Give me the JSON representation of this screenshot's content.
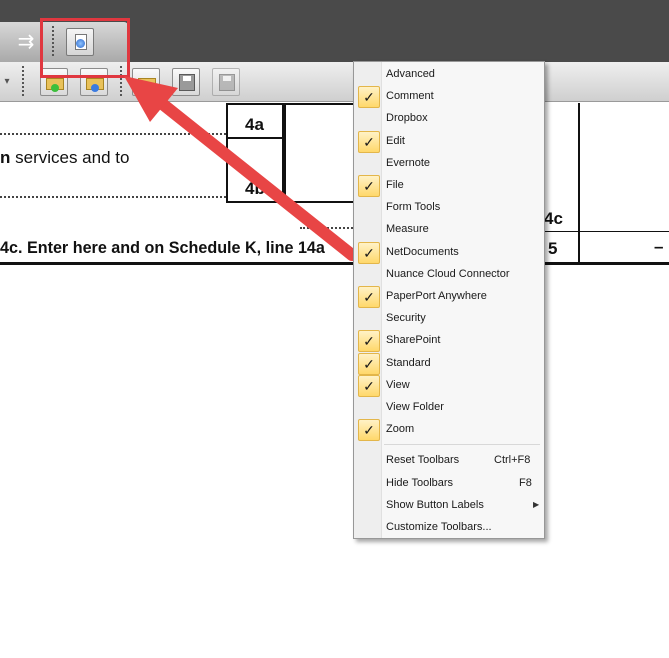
{
  "menu": {
    "items": [
      {
        "label": "Advanced",
        "checked": false
      },
      {
        "label": "Comment",
        "checked": true
      },
      {
        "label": "Dropbox",
        "checked": false
      },
      {
        "label": "Edit",
        "checked": true
      },
      {
        "label": "Evernote",
        "checked": false
      },
      {
        "label": "File",
        "checked": true
      },
      {
        "label": "Form Tools",
        "checked": false
      },
      {
        "label": "Measure",
        "checked": false
      },
      {
        "label": "NetDocuments",
        "checked": true
      },
      {
        "label": "Nuance Cloud Connector",
        "checked": false
      },
      {
        "label": "PaperPort Anywhere",
        "checked": true
      },
      {
        "label": "Security",
        "checked": false
      },
      {
        "label": "SharePoint",
        "checked": true
      },
      {
        "label": "Standard",
        "checked": true
      },
      {
        "label": "View",
        "checked": true
      },
      {
        "label": "View Folder",
        "checked": false
      },
      {
        "label": "Zoom",
        "checked": true
      }
    ],
    "actions": [
      {
        "label": "Reset Toolbars",
        "shortcut": "Ctrl+F8"
      },
      {
        "label": "Hide Toolbars",
        "shortcut": "F8"
      },
      {
        "label": "Show Button Labels",
        "shortcut": "",
        "submenu": true
      },
      {
        "label": "Customize Toolbars...",
        "shortcut": ""
      }
    ],
    "check_glyph": "✓",
    "submenu_glyph": "▶"
  },
  "document": {
    "line1_bold": "n",
    "line1_rest": " services and to",
    "line2": "4c.  Enter here and on Schedule K, line 14a",
    "box_label_top": "4a",
    "box_label_bottom": "4b",
    "right_label_4c": "4c",
    "right_label_5": "5",
    "dash": "–"
  },
  "toolbar": {
    "arrow_glyph": "⇉"
  },
  "colors": {
    "highlight": "#e0373f",
    "arrow": "#e84545",
    "check_bg": "#ffd86b"
  }
}
